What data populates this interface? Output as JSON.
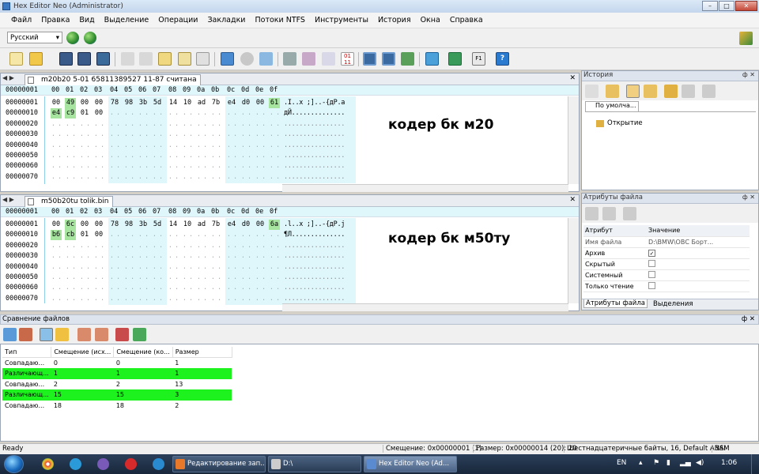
{
  "window": {
    "title": "Hex Editor Neo (Administrator)",
    "min": "–",
    "max": "□",
    "close": "✕"
  },
  "menu": [
    "Файл",
    "Правка",
    "Вид",
    "Выделение",
    "Операции",
    "Закладки",
    "Потоки NTFS",
    "Инструменты",
    "История",
    "Окна",
    "Справка"
  ],
  "language": {
    "selected": "Русский"
  },
  "editors": [
    {
      "tab": "m20b20 5-01 65811389527 11-87 считана",
      "offset_header": "00000001",
      "column_header": [
        "00",
        "01",
        "02",
        "03",
        "04",
        "05",
        "06",
        "07",
        "08",
        "09",
        "0a",
        "0b",
        "0c",
        "0d",
        "0e",
        "0f"
      ],
      "offsets": [
        "00000001",
        "00000010",
        "00000020",
        "00000030",
        "00000040",
        "00000050",
        "00000060",
        "00000070"
      ],
      "rows": [
        [
          "00",
          "49",
          "00",
          "00",
          "78",
          "98",
          "3b",
          "5d",
          "14",
          "10",
          "ad",
          "7b",
          "e4",
          "d0",
          "00",
          "61"
        ],
        [
          "e4",
          "c9",
          "01",
          "00"
        ]
      ],
      "highlight": [
        [
          0,
          1
        ],
        [
          0,
          15
        ],
        [
          1,
          0
        ],
        [
          1,
          1
        ]
      ],
      "ascii": [
        ".I..x ;]..-{дP.a",
        "дЙ.............."
      ],
      "note": "кодер бк м20"
    },
    {
      "tab": "m50b20tu tolik.bin",
      "offset_header": "00000001",
      "column_header": [
        "00",
        "01",
        "02",
        "03",
        "04",
        "05",
        "06",
        "07",
        "08",
        "09",
        "0a",
        "0b",
        "0c",
        "0d",
        "0e",
        "0f"
      ],
      "offsets": [
        "00000001",
        "00000010",
        "00000020",
        "00000030",
        "00000040",
        "00000050",
        "00000060",
        "00000070"
      ],
      "rows": [
        [
          "00",
          "6c",
          "00",
          "00",
          "78",
          "98",
          "3b",
          "5d",
          "14",
          "10",
          "ad",
          "7b",
          "e4",
          "d0",
          "00",
          "6a"
        ],
        [
          "b6",
          "cb",
          "01",
          "00"
        ]
      ],
      "highlight": [
        [
          0,
          1
        ],
        [
          0,
          15
        ],
        [
          1,
          0
        ],
        [
          1,
          1
        ]
      ],
      "ascii": [
        ".l..x ;]..-{дP.j",
        "¶Л.............."
      ],
      "note": "кодер бк м50ту"
    }
  ],
  "history": {
    "title": "История",
    "tab": "По умолча...",
    "item": "Открытие"
  },
  "attributes": {
    "title": "Атрибуты файла",
    "col_attr": "Атрибут",
    "col_value": "Значение",
    "rows": [
      {
        "name": "Имя файла",
        "value": "D:\\BMW\\ОВС Борт..."
      },
      {
        "name": "Архив",
        "checked": true
      },
      {
        "name": "Скрытый",
        "checked": false
      },
      {
        "name": "Системный",
        "checked": false
      },
      {
        "name": "Только чтение",
        "checked": false
      }
    ],
    "tab_attrs": "Атрибуты файла",
    "tab_sel": "Выделения"
  },
  "compare": {
    "title": "Сравнение файлов",
    "headers": [
      "Тип",
      "Смещение (исх...",
      "Смещение (ко...",
      "Размер"
    ],
    "rows": [
      {
        "type": "Совпадаю...",
        "off1": "0",
        "off2": "0",
        "size": "1",
        "diff": false
      },
      {
        "type": "Различающ...",
        "off1": "1",
        "off2": "1",
        "size": "1",
        "diff": true
      },
      {
        "type": "Совпадаю...",
        "off1": "2",
        "off2": "2",
        "size": "13",
        "diff": false
      },
      {
        "type": "Различающ...",
        "off1": "15",
        "off2": "15",
        "size": "3",
        "diff": true
      },
      {
        "type": "Совпадаю...",
        "off1": "18",
        "off2": "18",
        "size": "2",
        "diff": false
      }
    ]
  },
  "status": {
    "ready": "Ready",
    "offset": "Смещение: 0x00000001 (1)",
    "size": "Размер: 0x00000014 (20): 20",
    "mode": "Шестнадцатеричные байты, 16, Default ANSI",
    "ins": "ЗАМ"
  },
  "taskbar": {
    "tasks": [
      "Редактирование зап...",
      "D:\\",
      "Hex Editor Neo (Ad..."
    ],
    "lang": "EN",
    "time": "1:06"
  }
}
